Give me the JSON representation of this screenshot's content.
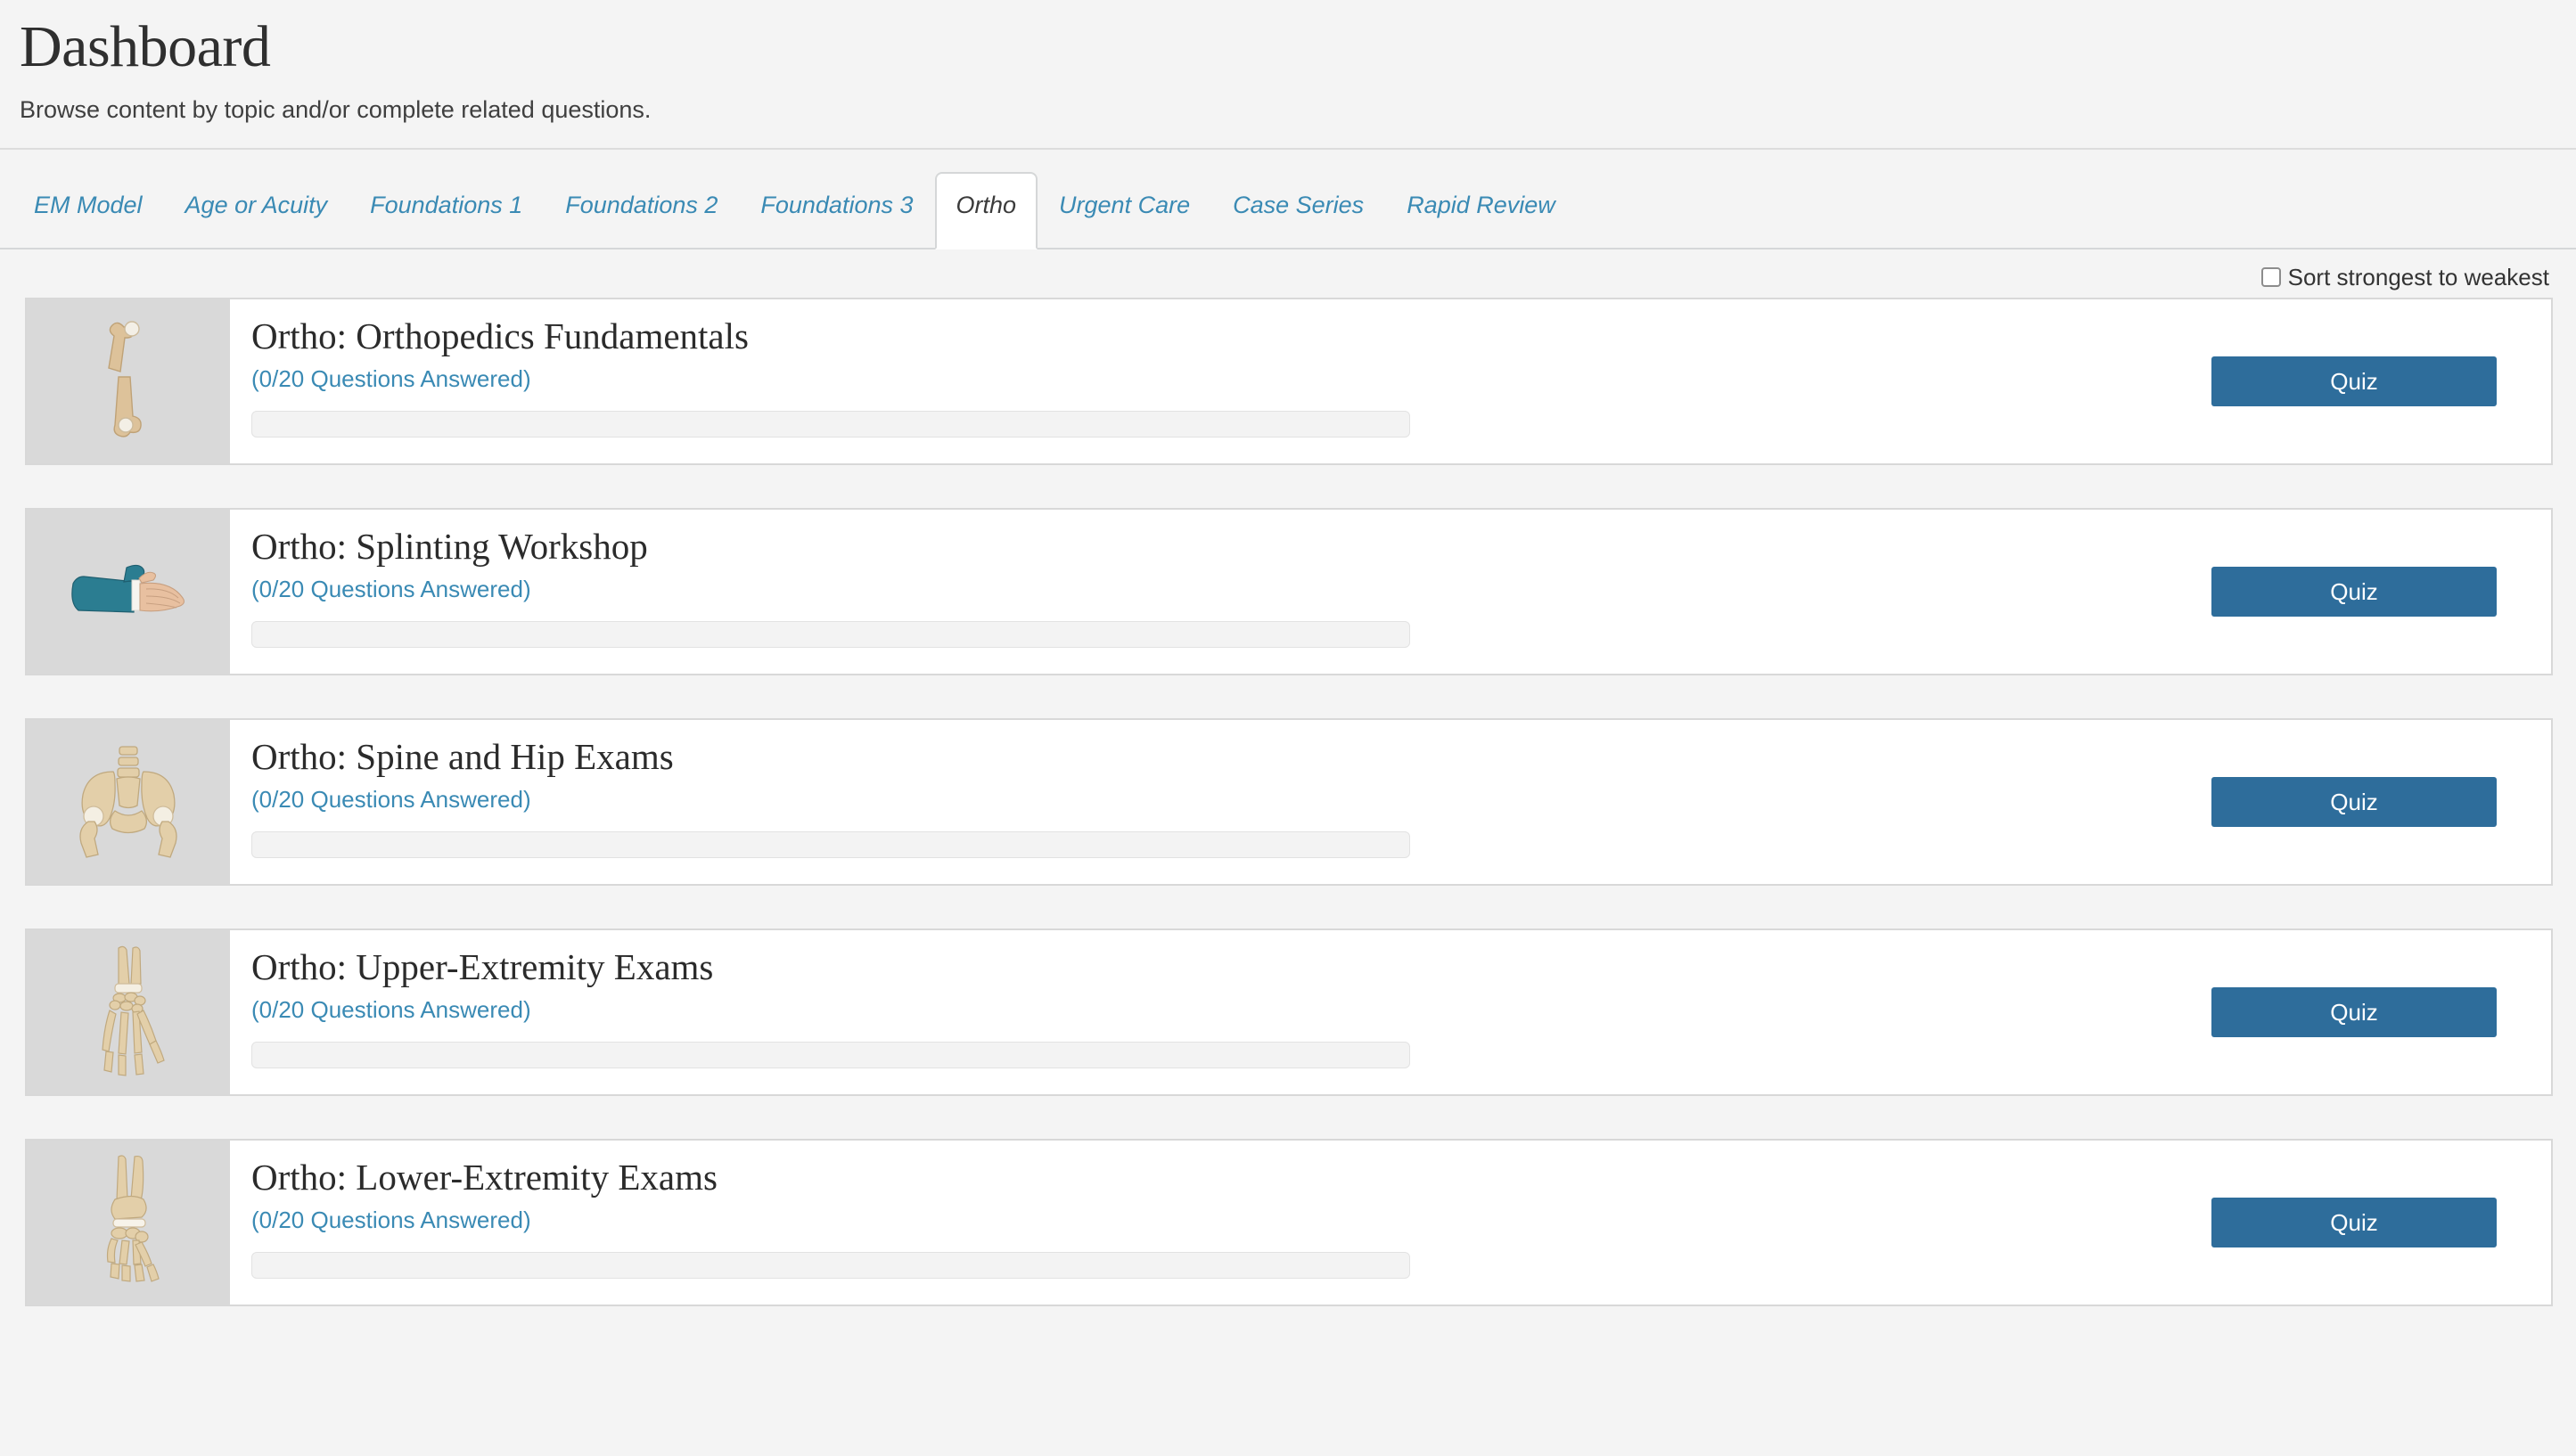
{
  "header": {
    "title": "Dashboard",
    "subtitle": "Browse content by topic and/or complete related questions."
  },
  "tabs": [
    {
      "label": "EM Model",
      "active": false
    },
    {
      "label": "Age or Acuity",
      "active": false
    },
    {
      "label": "Foundations 1",
      "active": false
    },
    {
      "label": "Foundations 2",
      "active": false
    },
    {
      "label": "Foundations 3",
      "active": false
    },
    {
      "label": "Ortho",
      "active": true
    },
    {
      "label": "Urgent Care",
      "active": false
    },
    {
      "label": "Case Series",
      "active": false
    },
    {
      "label": "Rapid Review",
      "active": false
    }
  ],
  "sort": {
    "label": "Sort strongest to weakest",
    "checked": false
  },
  "colors": {
    "accent_link": "#3a8ab4",
    "button": "#2e6d9b",
    "page_background": "#f4f4f4",
    "card_background": "#ffffff",
    "thumb_background": "#d9d9d9",
    "border": "#d8d8d8"
  },
  "cards": [
    {
      "title": "Ortho: Orthopedics Fundamentals",
      "progress_text": "(0/20 Questions Answered)",
      "answered": 0,
      "total": 20,
      "progress_percent": 0,
      "icon": "fractured-bone-icon",
      "button_label": "Quiz"
    },
    {
      "title": "Ortho: Splinting Workshop",
      "progress_text": "(0/20 Questions Answered)",
      "answered": 0,
      "total": 20,
      "progress_percent": 0,
      "icon": "splinted-hand-icon",
      "button_label": "Quiz"
    },
    {
      "title": "Ortho: Spine and Hip Exams",
      "progress_text": "(0/20 Questions Answered)",
      "answered": 0,
      "total": 20,
      "progress_percent": 0,
      "icon": "pelvis-bone-icon",
      "button_label": "Quiz"
    },
    {
      "title": "Ortho: Upper-Extremity Exams",
      "progress_text": "(0/20 Questions Answered)",
      "answered": 0,
      "total": 20,
      "progress_percent": 0,
      "icon": "hand-skeleton-icon",
      "button_label": "Quiz"
    },
    {
      "title": "Ortho: Lower-Extremity Exams",
      "progress_text": "(0/20 Questions Answered)",
      "answered": 0,
      "total": 20,
      "progress_percent": 0,
      "icon": "foot-skeleton-icon",
      "button_label": "Quiz"
    }
  ]
}
